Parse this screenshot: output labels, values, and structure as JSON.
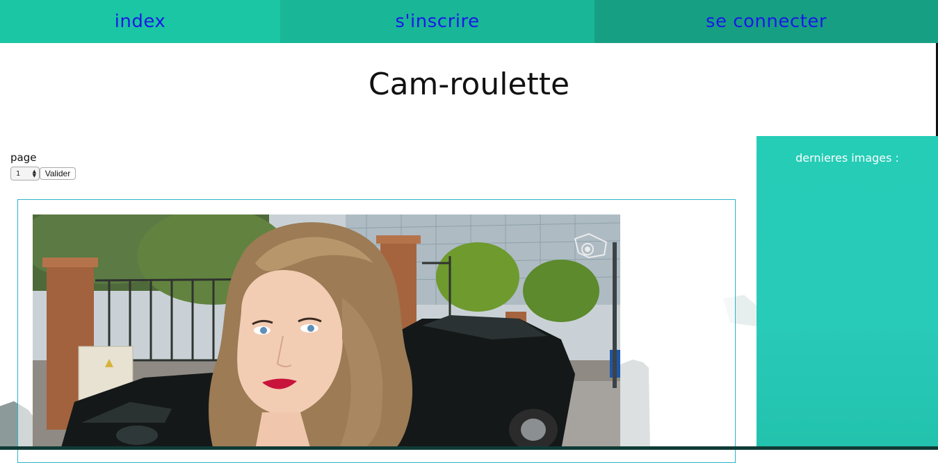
{
  "nav": {
    "items": [
      {
        "label": "index"
      },
      {
        "label": "s'inscrire"
      },
      {
        "label": "se connecter"
      }
    ]
  },
  "page": {
    "title": "Cam-roulette"
  },
  "pager": {
    "label": "page",
    "selected": "1",
    "submit_label": "Valider"
  },
  "sidebar": {
    "title": "dernieres images :"
  },
  "colors": {
    "nav_1": "#1bc6a4",
    "nav_2": "#19b698",
    "nav_3": "#179f84",
    "nav_text": "#1a1ae6",
    "sidebar_bg": "#25cdb6",
    "gallery_border": "#2ab3c6"
  },
  "icons": {
    "photo_overlay": "camera-sticker-icon"
  }
}
